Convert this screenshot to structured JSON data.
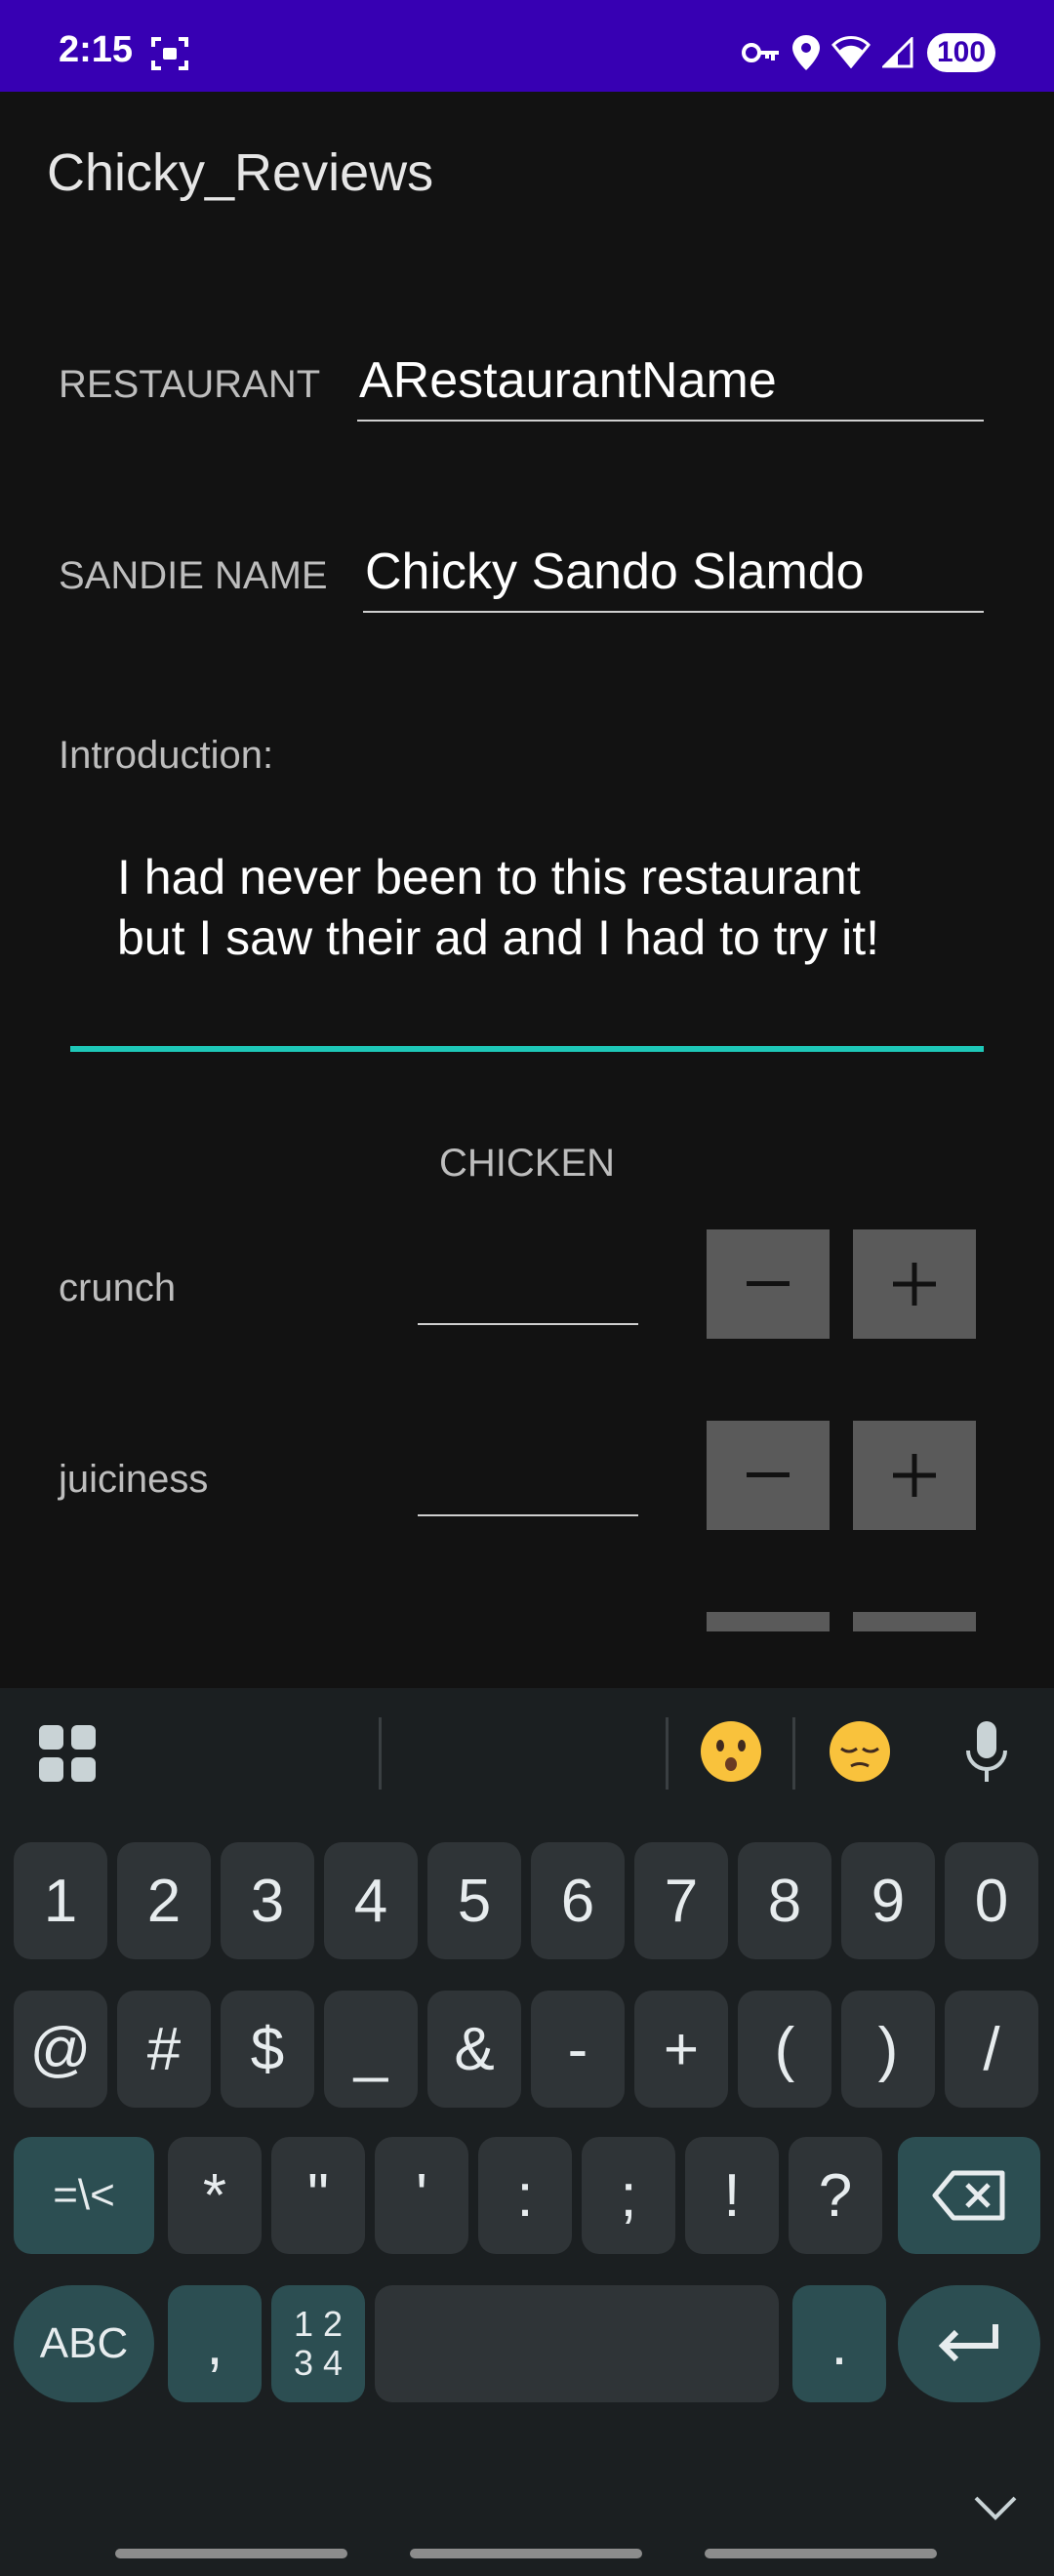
{
  "status_bar": {
    "time": "2:15",
    "battery": "100",
    "icons": [
      "screenshot-icon",
      "vpn-key-icon",
      "location-icon",
      "wifi-icon",
      "signal-icon",
      "battery-icon"
    ]
  },
  "app": {
    "title": "Chicky_Reviews",
    "restaurant_label": "RESTAURANT",
    "restaurant_value": "ARestaurantName",
    "sandie_label": "SANDIE NAME",
    "sandie_value": "Chicky Sando Slamdo",
    "intro_label": "Introduction:",
    "intro_line1": "I had never been to this restaurant",
    "intro_line2": "but I saw their ad and I had to try it!",
    "section_heading": "CHICKEN",
    "ratings": [
      {
        "label": "crunch",
        "value": ""
      },
      {
        "label": "juiciness",
        "value": ""
      }
    ],
    "accent_color": "#1ec8b8"
  },
  "keyboard": {
    "row1": [
      "1",
      "2",
      "3",
      "4",
      "5",
      "6",
      "7",
      "8",
      "9",
      "0"
    ],
    "row2": [
      "@",
      "#",
      "$",
      "_",
      "&",
      "-",
      "+",
      "(",
      ")",
      "/"
    ],
    "row3": [
      "=\\<",
      "*",
      "\"",
      "'",
      ":",
      ";",
      "!",
      "?"
    ],
    "row4": {
      "abc": "ABC",
      "comma": ",",
      "numpad": "1 2\n3 4",
      "period": "."
    }
  }
}
